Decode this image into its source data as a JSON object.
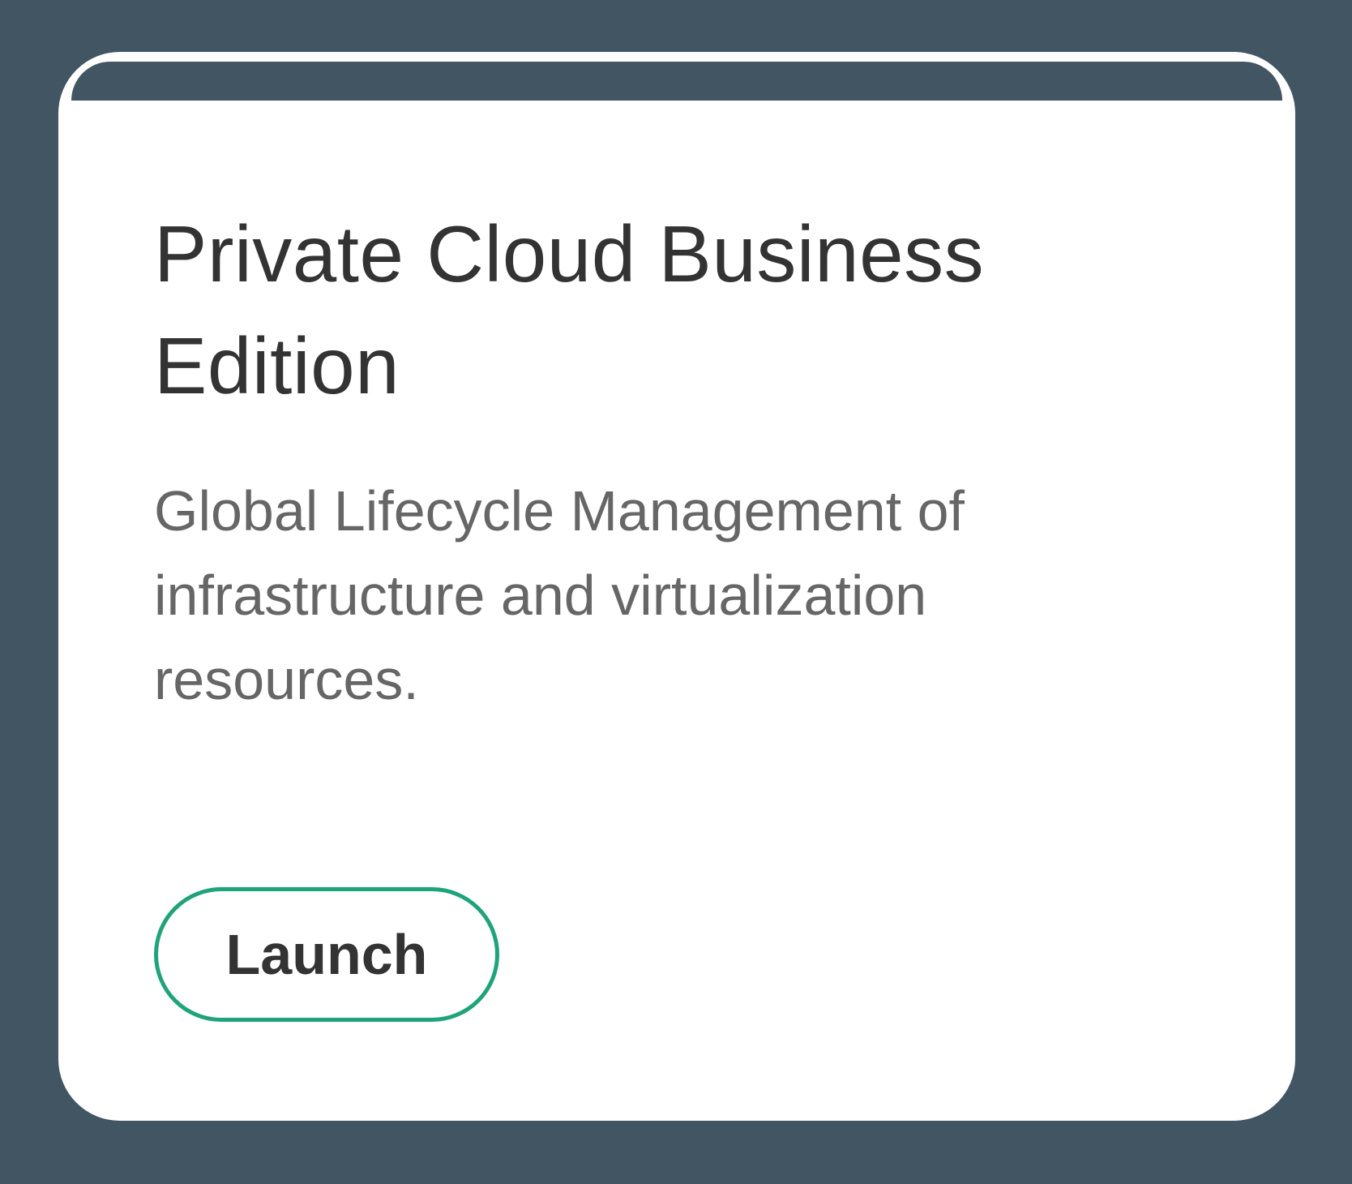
{
  "card": {
    "title": "Private Cloud Business Edition",
    "description": "Global Lifecycle Management of infrastructure and virtualization resources.",
    "launch_label": "Launch"
  },
  "colors": {
    "background": "#425563",
    "card": "#ffffff",
    "title_text": "#333333",
    "description_text": "#666666",
    "button_border": "#1fa37b"
  }
}
